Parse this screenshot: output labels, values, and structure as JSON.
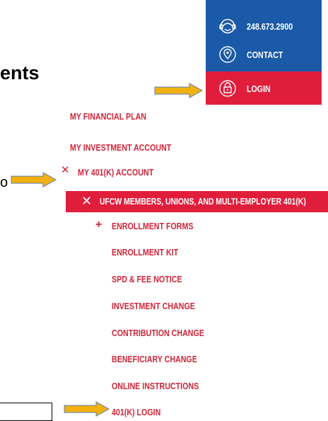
{
  "doc": {
    "heading_fragment": "ents",
    "text_fragment": "o"
  },
  "top_panel": {
    "phone": "248.673.2900",
    "contact": "CONTACT",
    "login": "LOGIN",
    "icons": [
      "headset-icon",
      "location-pin-icon",
      "padlock-icon"
    ],
    "colors": {
      "blue": "#1a5aa8",
      "red": "#e01e3c"
    }
  },
  "nav": {
    "items": [
      "MY FINANCIAL PLAN",
      "MY INVESTMENT ACCOUNT",
      "MY 401(K) ACCOUNT",
      "UFCW MEMBERS, UNIONS, AND MULTI-EMPLOYER 401(K)",
      "ENROLLMENT FORMS",
      "ENROLLMENT KIT",
      "SPD & FEE NOTICE",
      "INVESTMENT CHANGE",
      "CONTRIBUTION CHANGE",
      "BENEFICIARY CHANGE",
      "ONLINE INSTRUCTIONS",
      "401(K) LOGIN"
    ],
    "collapse_symbol": "✕",
    "expand_symbol": "+",
    "text_color": "#d0263a"
  },
  "annotations": {
    "arrow_color": "#f2b10f"
  }
}
